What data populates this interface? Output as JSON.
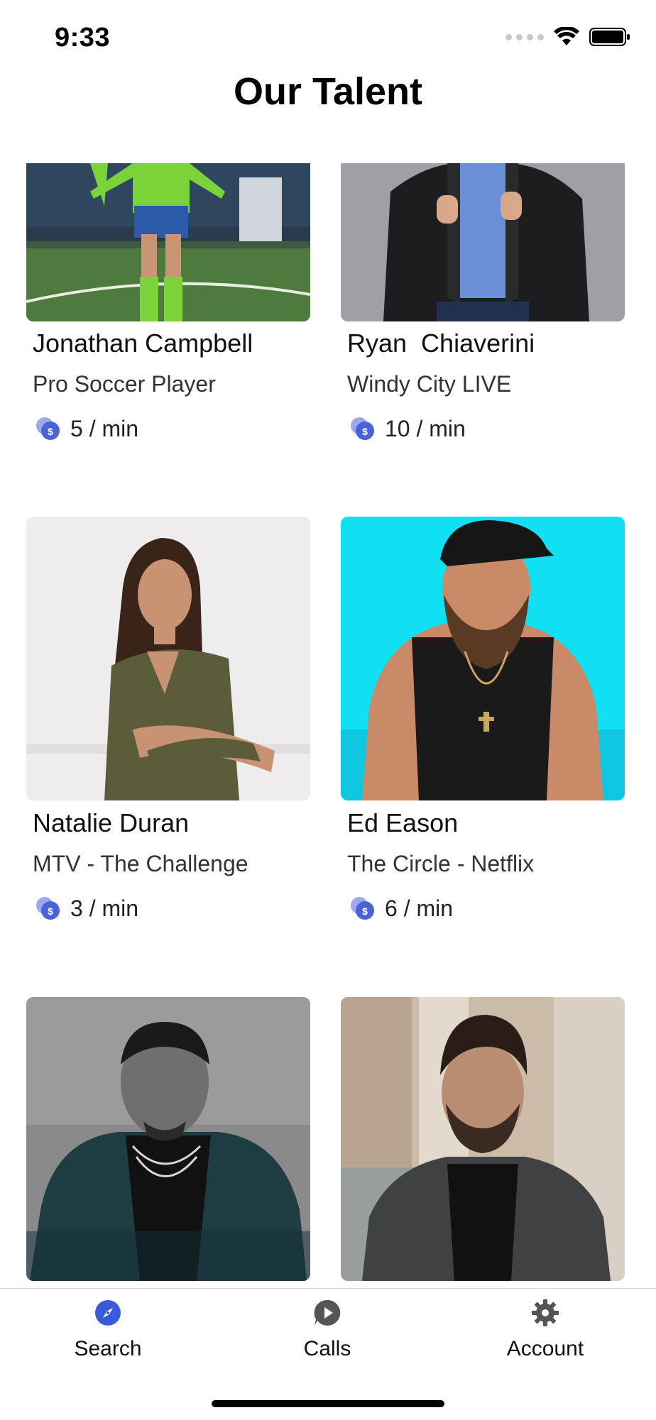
{
  "status_bar": {
    "time": "9:33"
  },
  "header": {
    "title": "Our Talent"
  },
  "talent": [
    {
      "name": "Jonathan Campbell",
      "role": "Pro Soccer Player",
      "rate": "5 / min"
    },
    {
      "name": "Ryan  Chiaverini",
      "role": "Windy City LIVE",
      "rate": "10 / min"
    },
    {
      "name": "Natalie Duran",
      "role": "MTV - The Challenge",
      "rate": "3 / min"
    },
    {
      "name": "Ed Eason",
      "role": "The Circle - Netflix",
      "rate": "6 / min"
    }
  ],
  "tab_bar": {
    "tabs": [
      {
        "label": "Search",
        "icon": "compass-icon",
        "selected": true
      },
      {
        "label": "Calls",
        "icon": "play-bubble-icon",
        "selected": false
      },
      {
        "label": "Account",
        "icon": "gear-icon",
        "selected": false
      }
    ]
  },
  "colors": {
    "accent": "#3a5bd9",
    "icon_gray": "#555555",
    "coin": "#4a63d8"
  }
}
